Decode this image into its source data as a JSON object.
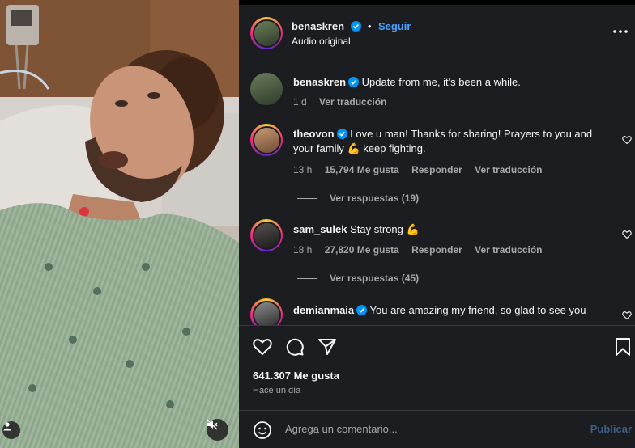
{
  "post": {
    "author": "benaskren",
    "follow_label": "Seguir",
    "separator": "•",
    "audio_label": "Audio original"
  },
  "comments": [
    {
      "username": "benaskren",
      "text": "Update from me, it's been a while.",
      "time": "1 d",
      "translate": "Ver traducción"
    },
    {
      "username": "theovon",
      "text": "Love u man! Thanks for sharing! Prayers to you and your family 💪 keep fighting.",
      "time": "13 h",
      "likes": "15,794 Me gusta",
      "reply": "Responder",
      "translate": "Ver traducción",
      "view_replies": "Ver respuestas (19)"
    },
    {
      "username": "sam_sulek",
      "text": "Stay strong 💪",
      "time": "18 h",
      "likes": "27,820 Me gusta",
      "reply": "Responder",
      "translate": "Ver traducción",
      "view_replies": "Ver respuestas (45)"
    },
    {
      "username": "demianmaia",
      "text": "You are amazing my friend, so glad to see you"
    }
  ],
  "stats": {
    "likes": "641.307 Me gusta",
    "time": "Hace un día"
  },
  "add_comment": {
    "placeholder": "Agrega un comentario...",
    "publish": "Publicar"
  },
  "colors": {
    "panel_bg": "#1c1d20",
    "link_blue": "#4aa3ff",
    "verified_blue": "#0095f6",
    "muted_text": "#a8a8a8"
  },
  "icons": [
    "user-icon",
    "mute-icon",
    "verified-icon",
    "more-options-icon",
    "heart-icon",
    "comment-icon",
    "share-icon",
    "bookmark-icon",
    "emoji-icon"
  ]
}
